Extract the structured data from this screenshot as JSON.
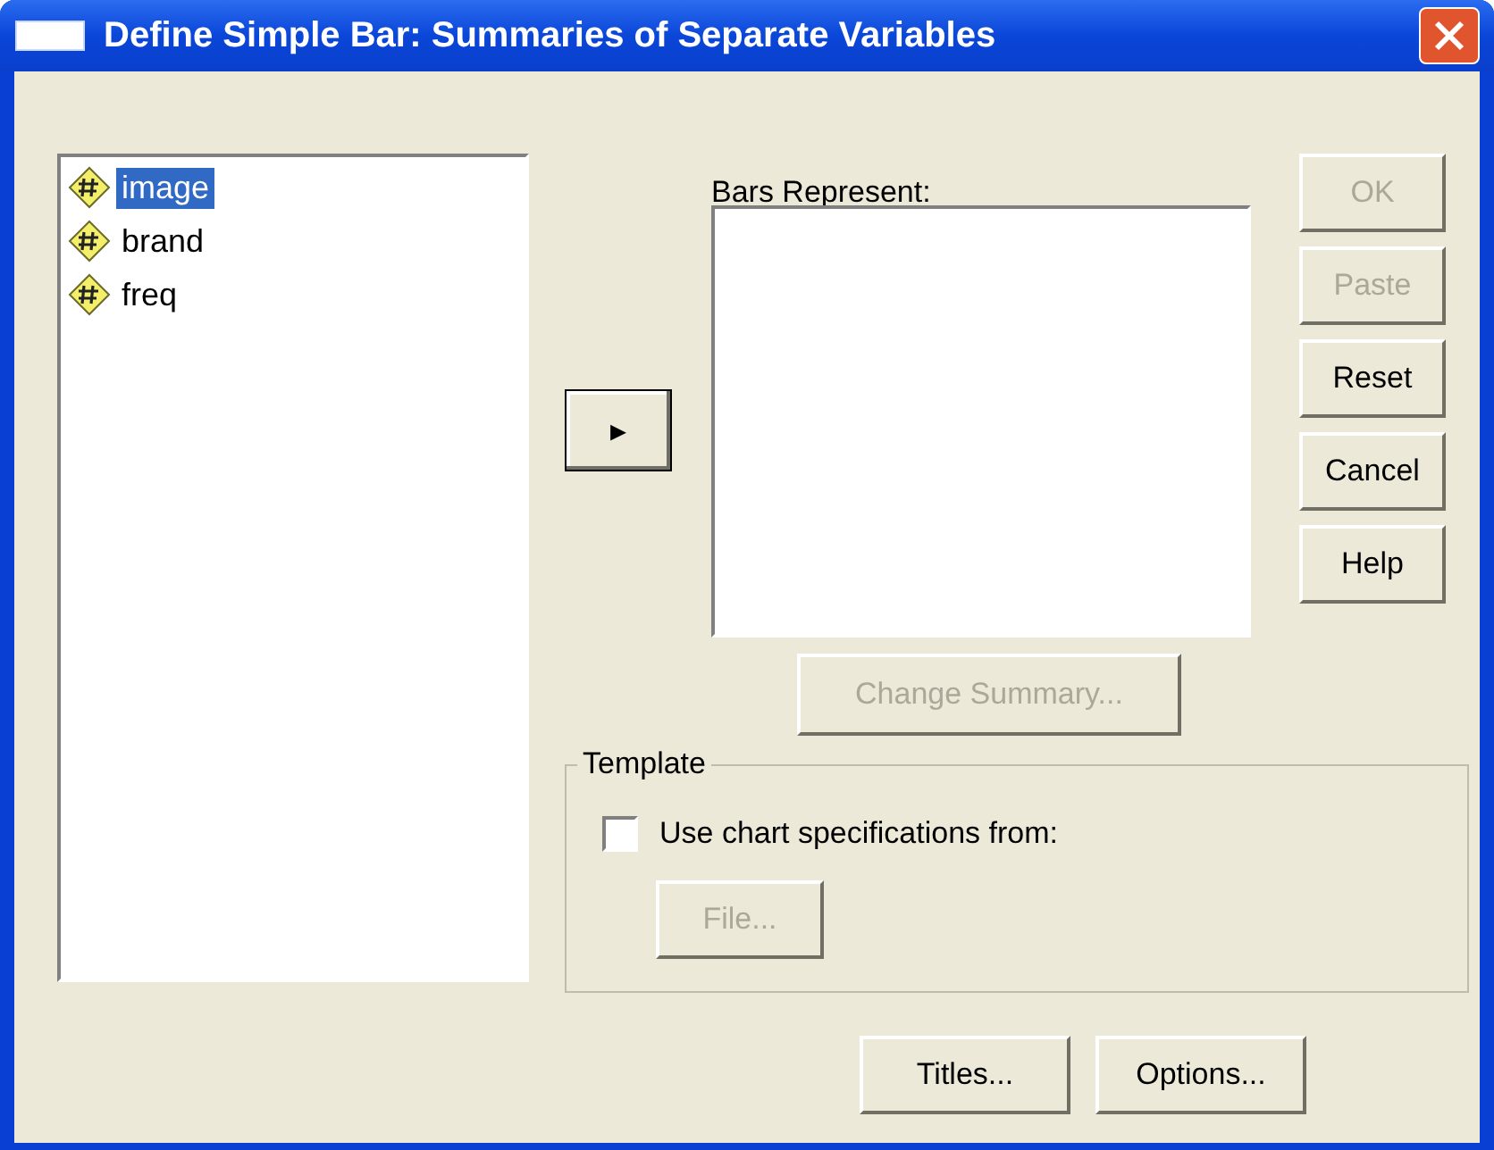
{
  "window": {
    "title": "Define Simple Bar: Summaries of Separate Variables"
  },
  "variables": [
    {
      "name": "image",
      "selected": true
    },
    {
      "name": "brand",
      "selected": false
    },
    {
      "name": "freq",
      "selected": false
    }
  ],
  "move_button": {
    "label": "▸"
  },
  "bars_represent": {
    "label": "Bars Represent:"
  },
  "side_buttons": [
    {
      "label": "OK",
      "disabled": true
    },
    {
      "label": "Paste",
      "disabled": true
    },
    {
      "label": "Reset",
      "disabled": false
    },
    {
      "label": "Cancel",
      "disabled": false
    },
    {
      "label": "Help",
      "disabled": false
    }
  ],
  "change_summary": {
    "label": "Change Summary...",
    "disabled": true
  },
  "template": {
    "title": "Template",
    "checkbox": {
      "label": "Use chart specifications from:",
      "checked": false
    },
    "file_button": {
      "label": "File...",
      "disabled": true
    }
  },
  "bottom_buttons": [
    {
      "label": "Titles...",
      "disabled": false
    },
    {
      "label": "Options...",
      "disabled": false
    }
  ]
}
